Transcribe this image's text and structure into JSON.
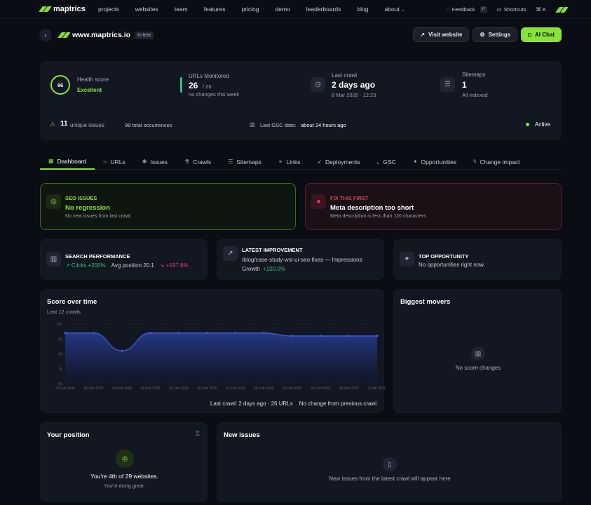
{
  "nav": {
    "brand": "maptrics",
    "links": [
      "projects",
      "websites",
      "team",
      "features",
      "pricing",
      "demo",
      "leaderboards",
      "blog",
      "about"
    ],
    "feedback": "Feedback",
    "feedback_key": "F",
    "shortcuts": "Shortcuts",
    "command_key": "⌘ K"
  },
  "header": {
    "site": "www.maptrics.io",
    "badge": "In test",
    "visit": "Visit website",
    "settings": "Settings",
    "ai_chat": "AI Chat"
  },
  "stats": {
    "health_value": "96",
    "health_label": "Health score",
    "health_status": "Excellent",
    "urls_label": "URLs Monitored",
    "urls_value": "26",
    "urls_total": "/ 26",
    "urls_sub": "no changes this week",
    "crawl_label": "Last crawl",
    "crawl_value": "2 days ago",
    "crawl_sub": "8 Mar 2026 · 12:23",
    "sitemaps_label": "Sitemaps",
    "sitemaps_value": "1",
    "sitemaps_sub": "All indexed",
    "unique_issues_value": "11",
    "unique_issues_label": "unique issues",
    "occurrences": "98 total occurrences",
    "gsc_label": "Last GSC data:",
    "gsc_value": "about 24 hours ago",
    "status": "Active"
  },
  "tabs": [
    "Dashboard",
    "URLs",
    "Issues",
    "Crawls",
    "Sitemaps",
    "Links",
    "Deployments",
    "GSC",
    "Opportunities",
    "Change impact"
  ],
  "seo_card": {
    "title": "SEO ISSUES",
    "main": "No regression",
    "sub": "No new issues from last crawl."
  },
  "fix_card": {
    "title": "FIX THIS FIRST",
    "main": "Meta description too short",
    "sub": "Meta description is less than 120 characters"
  },
  "search_perf": {
    "title": "SEARCH PERFORMANCE",
    "clicks": "↗ Clicks +200%",
    "avg_pos": "Avg position 20.1",
    "avg_change": "↘ +197.8%"
  },
  "latest_improvement": {
    "title": "LATEST IMPROVEMENT",
    "line1": "/blog/case-study-wsl-ui-seo-fixes — Impressions",
    "growth_label": "Growth",
    "growth_value": "+100.0%"
  },
  "top_opportunity": {
    "title": "TOP OPPORTUNITY",
    "sub": "No opportunities right now."
  },
  "score_chart": {
    "title": "Score over time",
    "subtitle": "Last 12 crawls",
    "foot_left": "Last crawl: 2 days ago · 26 URLs",
    "foot_right": "No change from previous crawl"
  },
  "chart_data": {
    "type": "area",
    "x": [
      "26 Feb 2026",
      "26 Feb 2026",
      "26 Feb 2026",
      "26 Feb 2026",
      "26 Feb 2026",
      "26 Feb 2026",
      "26 Feb 2026",
      "26 Feb 2026",
      "26 Feb 2026",
      "26 Feb 2026",
      "26 Feb 2026",
      "8 Mar 2026"
    ],
    "series": [
      {
        "values": [
          97,
          97,
          91,
          97,
          97,
          97,
          97,
          97,
          96,
          96,
          96,
          96
        ]
      }
    ],
    "yticks": [
      100,
      95,
      90,
      75,
      50
    ],
    "ylim": [
      50,
      100
    ],
    "color": "#3b5bd6"
  },
  "movers": {
    "title": "Biggest movers",
    "empty": "No score changes"
  },
  "position": {
    "title": "Your position",
    "main": "You're 4th of 29 websites.",
    "sub": "You're doing great."
  },
  "new_issues": {
    "title": "New issues",
    "empty": "New issues from the latest crawl will appear here"
  },
  "colors": {
    "accent": "#86e33a",
    "danger": "#e0435a",
    "success": "#3fb984",
    "bg": "#0a0d14",
    "card": "#121722"
  }
}
